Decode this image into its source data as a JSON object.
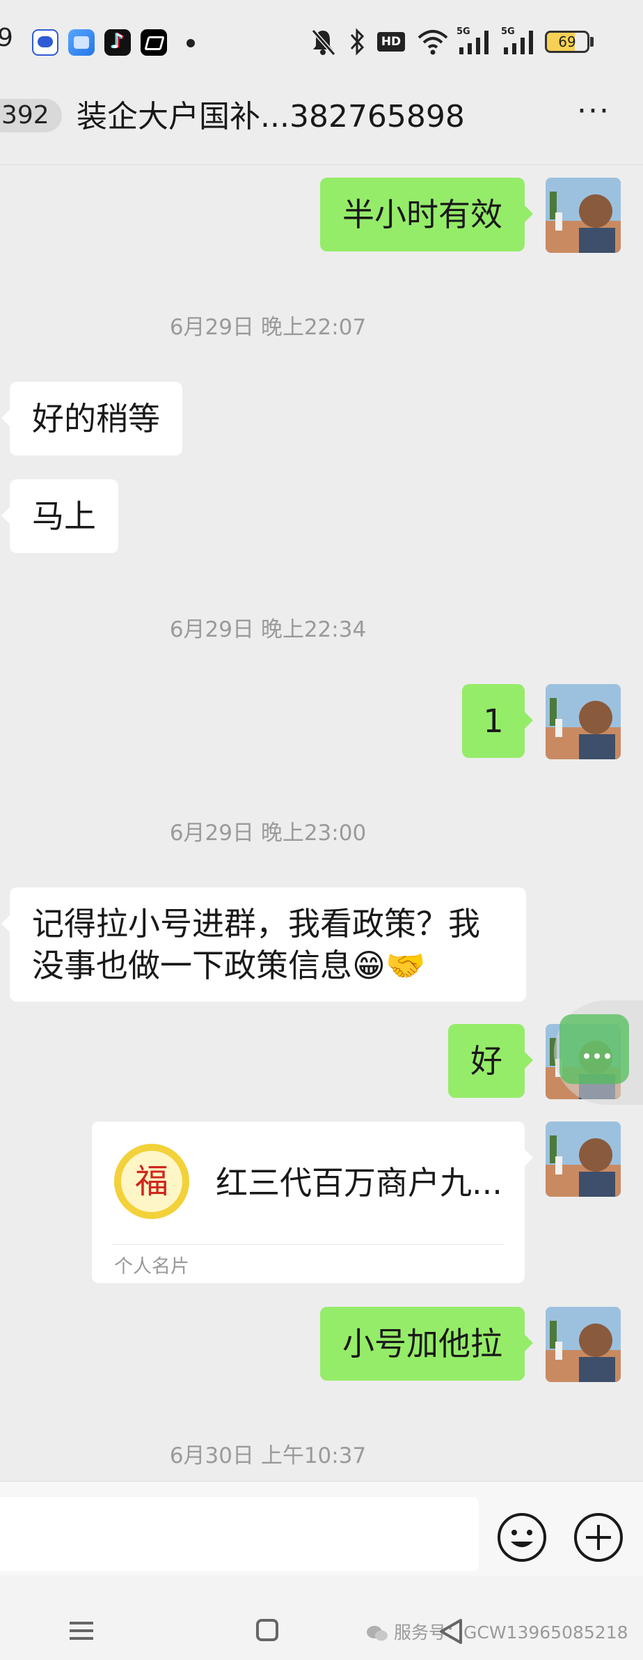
{
  "status_bar": {
    "time": "9",
    "network_badge": "HD",
    "signal_1": "5G",
    "signal_2": "5G",
    "battery_percent": 69
  },
  "header": {
    "unread_count": "392",
    "title": "装企大户国补...382765898",
    "more_label": "···"
  },
  "messages": [
    {
      "kind": "out",
      "text": "半小时有效"
    },
    {
      "kind": "time",
      "text": "6月29日 晚上22:07"
    },
    {
      "kind": "in",
      "text": "好的稍等"
    },
    {
      "kind": "in",
      "text": "马上"
    },
    {
      "kind": "time",
      "text": "6月29日 晚上22:34"
    },
    {
      "kind": "out",
      "text": "1"
    },
    {
      "kind": "time",
      "text": "6月29日 晚上23:00"
    },
    {
      "kind": "in",
      "text": "记得拉小号进群，我看政策？我没事也做一下政策信息😁🤝"
    },
    {
      "kind": "out",
      "text": "好"
    },
    {
      "kind": "card",
      "name": "红三代百万商户九...",
      "type": "个人名片",
      "logo_char": "福"
    },
    {
      "kind": "out",
      "text": "小号加他拉"
    },
    {
      "kind": "time",
      "text": "6月30日 上午10:37"
    }
  ],
  "input_bar": {
    "value": "",
    "emoji_icon": "smile-icon",
    "plus_icon": "plus-circle-icon"
  },
  "watermark": {
    "text": "服务号：GCW13965085218"
  },
  "colors": {
    "background": "#ededed",
    "outgoing_bubble": "#95ec69",
    "incoming_bubble": "#ffffff",
    "timestamp": "#9a9a9a"
  }
}
